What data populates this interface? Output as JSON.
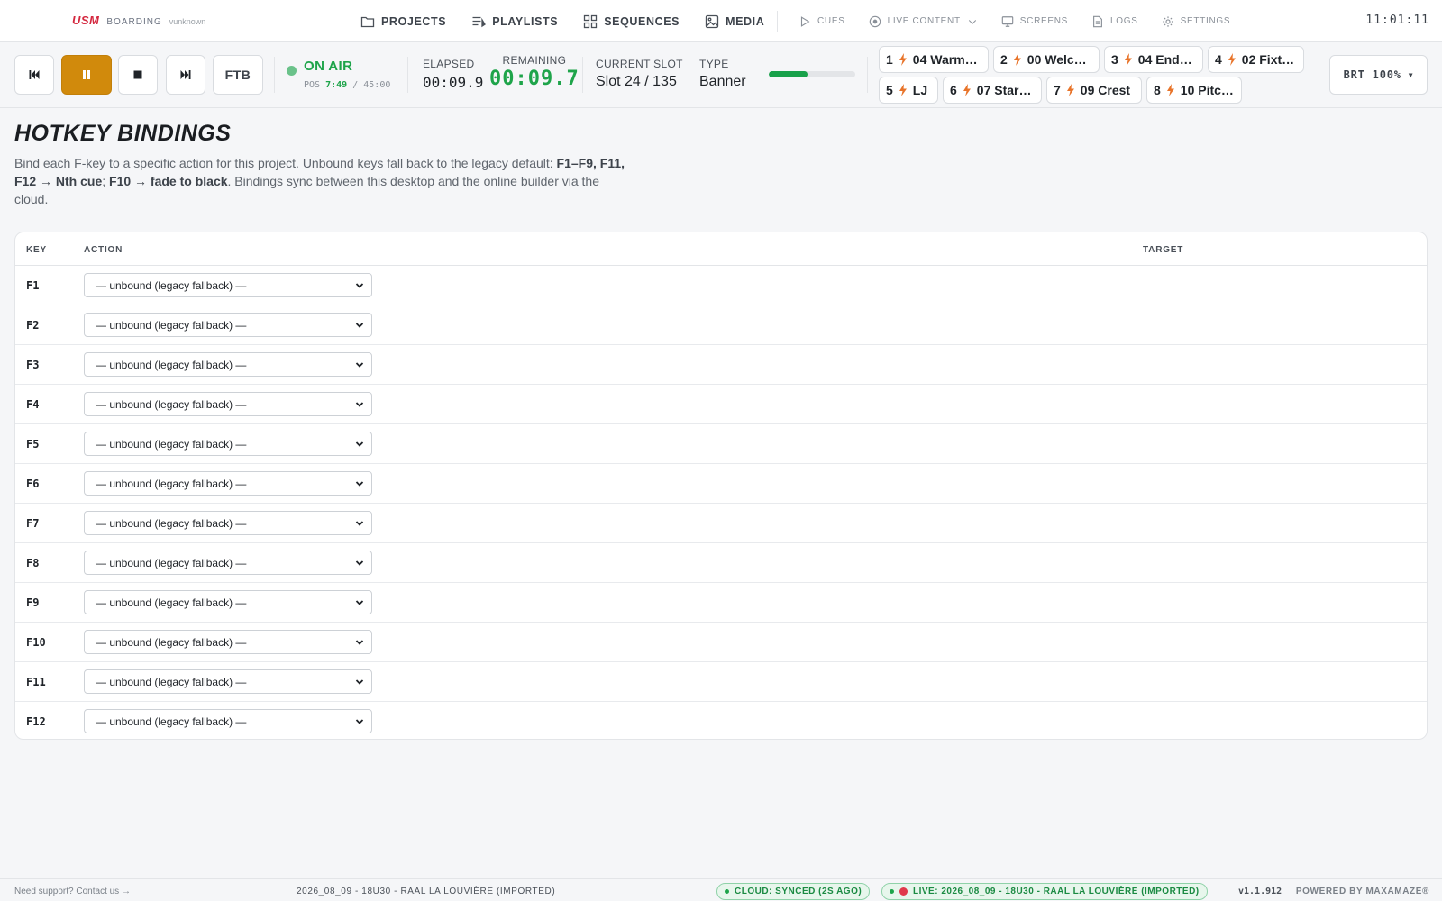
{
  "brand": {
    "logo": "USM",
    "app": "BOARDING",
    "user": "vunknown"
  },
  "nav": {
    "main": [
      {
        "label": "PROJECTS",
        "icon": "folder-icon"
      },
      {
        "label": "PLAYLISTS",
        "icon": "playlist-icon"
      },
      {
        "label": "SEQUENCES",
        "icon": "grid-icon"
      },
      {
        "label": "MEDIA",
        "icon": "image-icon"
      }
    ],
    "sub": [
      {
        "label": "CUES",
        "icon": "play-outline-icon"
      },
      {
        "label": "LIVE CONTENT",
        "icon": "live-circle-icon"
      },
      {
        "label": "SCREENS",
        "icon": "monitor-icon"
      },
      {
        "label": "LOGS",
        "icon": "document-icon"
      },
      {
        "label": "SETTINGS",
        "icon": "gear-icon"
      }
    ],
    "clock": "11:01:11"
  },
  "transport": {
    "ftb_label": "FTB",
    "status": "ON AIR",
    "pos_label": "POS",
    "pos_current": "7:49",
    "pos_total": "/ 45:00",
    "elapsed_label": "ELAPSED",
    "elapsed": "00:09.9",
    "remaining_label": "REMAINING",
    "remaining": "00:09.7",
    "slot_label": "CURRENT SLOT",
    "slot": "Slot 24 / 135",
    "type_label": "TYPE",
    "type": "Banner",
    "progress_fraction": 0.45,
    "brightness": "BRT 100%",
    "cues": [
      {
        "num": "1",
        "label": "04 Warm…"
      },
      {
        "num": "2",
        "label": "00 Welc…"
      },
      {
        "num": "3",
        "label": "04 End…"
      },
      {
        "num": "4",
        "label": "02 Fixt…"
      },
      {
        "num": "5",
        "label": "LJ"
      },
      {
        "num": "6",
        "label": "07 Star…"
      },
      {
        "num": "7",
        "label": "09 Crest"
      },
      {
        "num": "8",
        "label": "10 Pitc…"
      }
    ]
  },
  "page": {
    "title": "HOTKEY BINDINGS",
    "intro_1": "Bind each F-key to a specific action for this project. Unbound keys fall back to the legacy default: ",
    "intro_b1": "F1–F9, F11, F12 → Nth cue",
    "intro_2": "; ",
    "intro_b2": "F10 → fade to black",
    "intro_3": ". Bindings sync between this desktop and the online builder via the cloud."
  },
  "table": {
    "headers": {
      "key": "KEY",
      "action": "ACTION",
      "target": "TARGET"
    },
    "rows": [
      {
        "key": "F1",
        "action": "— unbound (legacy fallback) —"
      },
      {
        "key": "F2",
        "action": "— unbound (legacy fallback) —"
      },
      {
        "key": "F3",
        "action": "— unbound (legacy fallback) —"
      },
      {
        "key": "F4",
        "action": "— unbound (legacy fallback) —"
      },
      {
        "key": "F5",
        "action": "— unbound (legacy fallback) —"
      },
      {
        "key": "F6",
        "action": "— unbound (legacy fallback) —"
      },
      {
        "key": "F7",
        "action": "— unbound (legacy fallback) —"
      },
      {
        "key": "F8",
        "action": "— unbound (legacy fallback) —"
      },
      {
        "key": "F9",
        "action": "— unbound (legacy fallback) —"
      },
      {
        "key": "F10",
        "action": "— unbound (legacy fallback) —"
      },
      {
        "key": "F11",
        "action": "— unbound (legacy fallback) —"
      },
      {
        "key": "F12",
        "action": "— unbound (legacy fallback) —"
      }
    ]
  },
  "footer": {
    "support": "Need support? Contact us →",
    "project": "2026_08_09 - 18U30 - RAAL LA LOUVIÈRE (IMPORTED)",
    "cloud": "CLOUD: SYNCED (2S AGO)",
    "live": "LIVE: 2026_08_09 - 18U30 - RAAL LA LOUVIÈRE (IMPORTED)",
    "version": "v1.1.912",
    "powered": "POWERED BY MAXAMAZE®"
  },
  "colors": {
    "accent_orange": "#d18a0c",
    "on_air_green": "#1ea44a",
    "brand_red": "#d4283f",
    "bolt_orange": "#e8742a"
  }
}
